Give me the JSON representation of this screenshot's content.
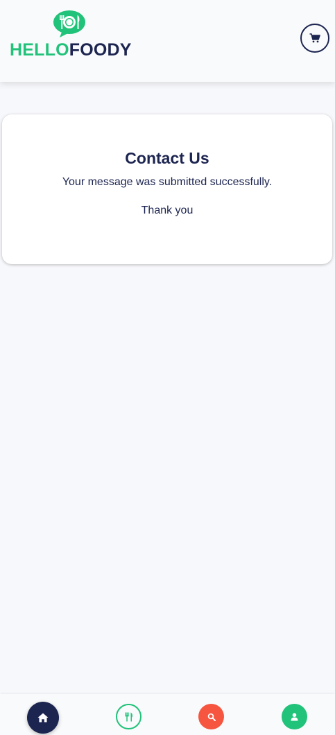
{
  "brand": {
    "name_part1": "HELLO",
    "name_part2": "FOODY",
    "logo_icon": "plate-cutlery-speech-bubble-icon",
    "primary_color": "#21c27a",
    "secondary_color": "#1c2450"
  },
  "header": {
    "cart_icon": "shopping-cart-icon"
  },
  "contact": {
    "title": "Contact Us",
    "message": "Your message was submitted successfully.",
    "thanks": "Thank you"
  },
  "bottom_nav": {
    "items": [
      {
        "icon": "home-icon",
        "color": "#1c2450",
        "active": true
      },
      {
        "icon": "utensils-icon",
        "color": "#21c27a",
        "active": false
      },
      {
        "icon": "search-icon",
        "color": "#f6553f",
        "active": false
      },
      {
        "icon": "user-icon",
        "color": "#21c27a",
        "active": false
      }
    ]
  }
}
